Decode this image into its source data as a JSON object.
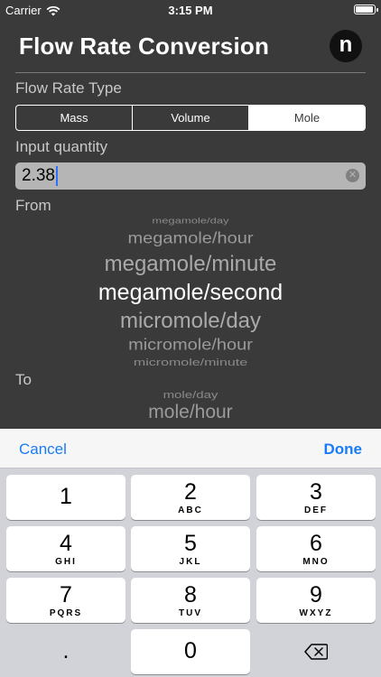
{
  "status_bar": {
    "carrier": "Carrier",
    "time": "3:15 PM",
    "battery_level": 0.95
  },
  "header": {
    "title": "Flow Rate Conversion",
    "logo_letter": "n"
  },
  "flow_type": {
    "label": "Flow Rate Type",
    "options": [
      "Mass",
      "Volume",
      "Mole"
    ],
    "selected": "Mole"
  },
  "input": {
    "label": "Input quantity",
    "value": "2.38"
  },
  "from": {
    "label": "From",
    "items": [
      "megamole/day",
      "megamole/hour",
      "megamole/minute",
      "megamole/second",
      "micromole/day",
      "micromole/hour",
      "micromole/minute"
    ],
    "selected": "megamole/second"
  },
  "to": {
    "label": "To",
    "items": [
      "mole/day",
      "mole/hour"
    ]
  },
  "keyboard": {
    "cancel": "Cancel",
    "done": "Done",
    "keys": [
      {
        "digit": "1",
        "letters": ""
      },
      {
        "digit": "2",
        "letters": "ABC"
      },
      {
        "digit": "3",
        "letters": "DEF"
      },
      {
        "digit": "4",
        "letters": "GHI"
      },
      {
        "digit": "5",
        "letters": "JKL"
      },
      {
        "digit": "6",
        "letters": "MNO"
      },
      {
        "digit": "7",
        "letters": "PQRS"
      },
      {
        "digit": "8",
        "letters": "TUV"
      },
      {
        "digit": "9",
        "letters": "WXYZ"
      },
      {
        "digit": ".",
        "letters": ""
      },
      {
        "digit": "0",
        "letters": ""
      }
    ],
    "delete_icon": "backspace-icon"
  },
  "colors": {
    "background": "#3a3a3a",
    "accent": "#1a7cf5",
    "keyboard": "#d1d3d9"
  }
}
